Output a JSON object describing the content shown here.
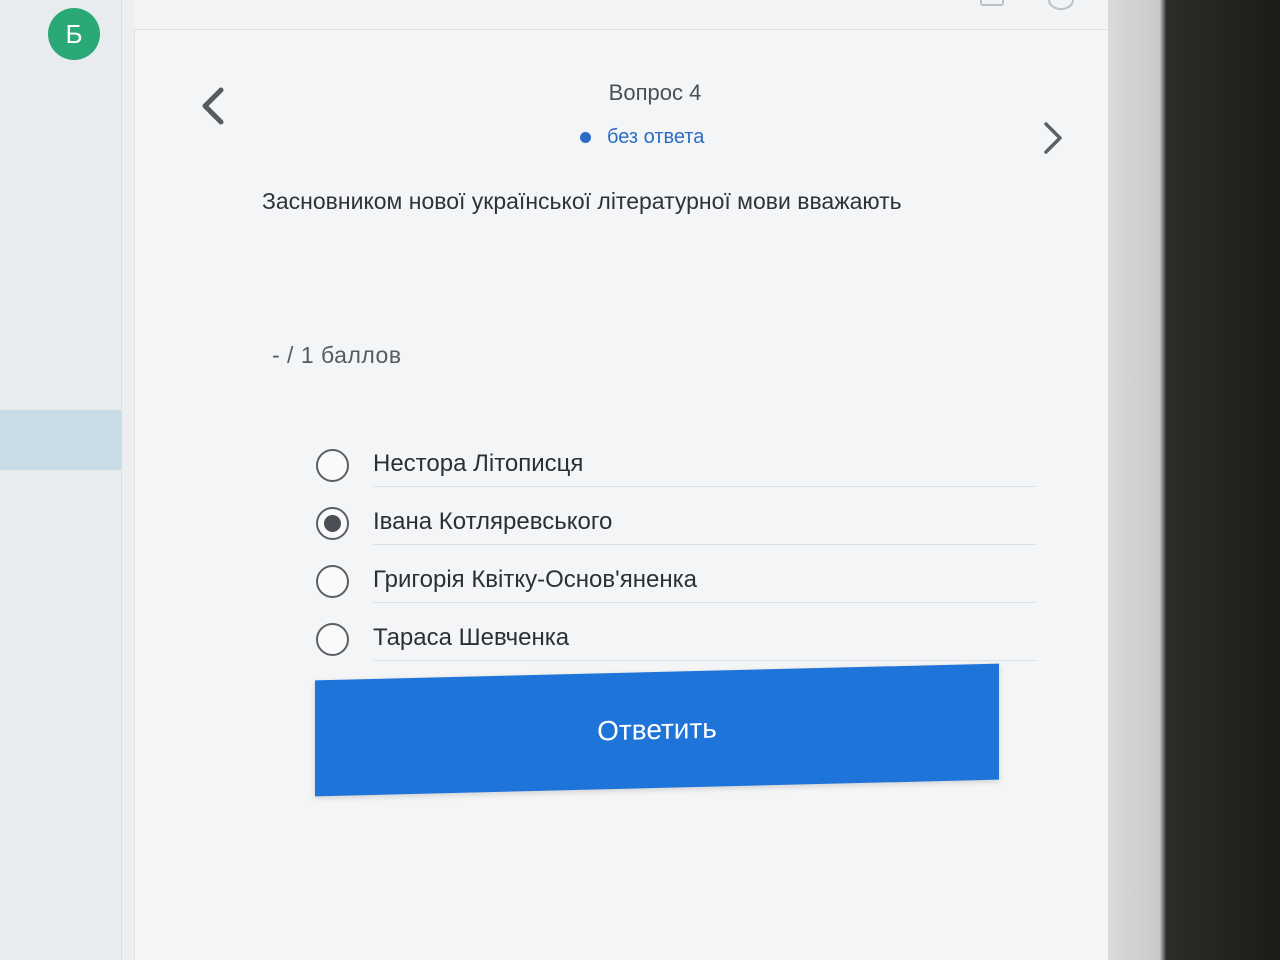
{
  "user": {
    "avatar_letter": "Б"
  },
  "header": {
    "question_title": "Вопрос 4",
    "status": "без ответа"
  },
  "question": {
    "text": "Засновником нової української літературної мови вважають",
    "points": "- / 1  баллов"
  },
  "options": [
    {
      "label": "Нестора Літописця",
      "selected": false
    },
    {
      "label": "Івана Котляревського",
      "selected": true
    },
    {
      "label": "Григорія Квітку-Основ'яненка",
      "selected": false
    },
    {
      "label": "Тараса Шевченка",
      "selected": false
    }
  ],
  "actions": {
    "submit_label": "Ответить"
  },
  "colors": {
    "accent": "#1f74d9",
    "status": "#2b6cc4",
    "avatar": "#2aa876"
  }
}
